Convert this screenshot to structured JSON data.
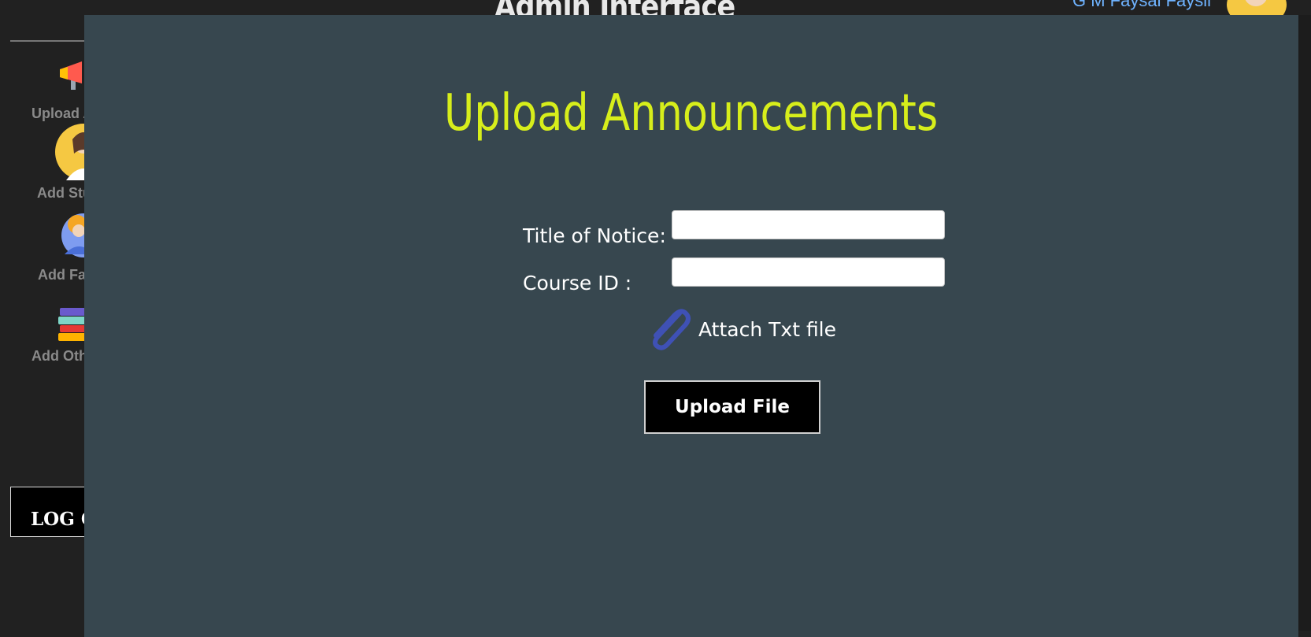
{
  "header": {
    "title": "Admin Interface",
    "user_name": "G M Faysal Faysil"
  },
  "sidebar": {
    "items": [
      {
        "label": "Upload Announcements",
        "icon": "megaphone-icon"
      },
      {
        "label": "Add Student",
        "icon": "student-avatar-icon"
      },
      {
        "label": "Add Faculty",
        "icon": "faculty-avatar-icon"
      },
      {
        "label": "Add Others",
        "icon": "books-icon"
      }
    ],
    "logout_label": "LOG OUT"
  },
  "background_fragments": [
    "ce",
    "un"
  ],
  "modal": {
    "title": "Upload Announcements",
    "fields": [
      {
        "label": "Title of Notice:",
        "value": "",
        "placeholder": ""
      },
      {
        "label": "Course ID :",
        "value": "",
        "placeholder": ""
      }
    ],
    "attach_label": "Attach Txt file",
    "attach_icon": "paperclip-icon",
    "upload_button_label": "Upload File"
  },
  "colors": {
    "modal_bg": "#37474f",
    "title_accent": "#d7ee1b",
    "page_bg": "#212121",
    "paperclip": "#3f51b5"
  }
}
